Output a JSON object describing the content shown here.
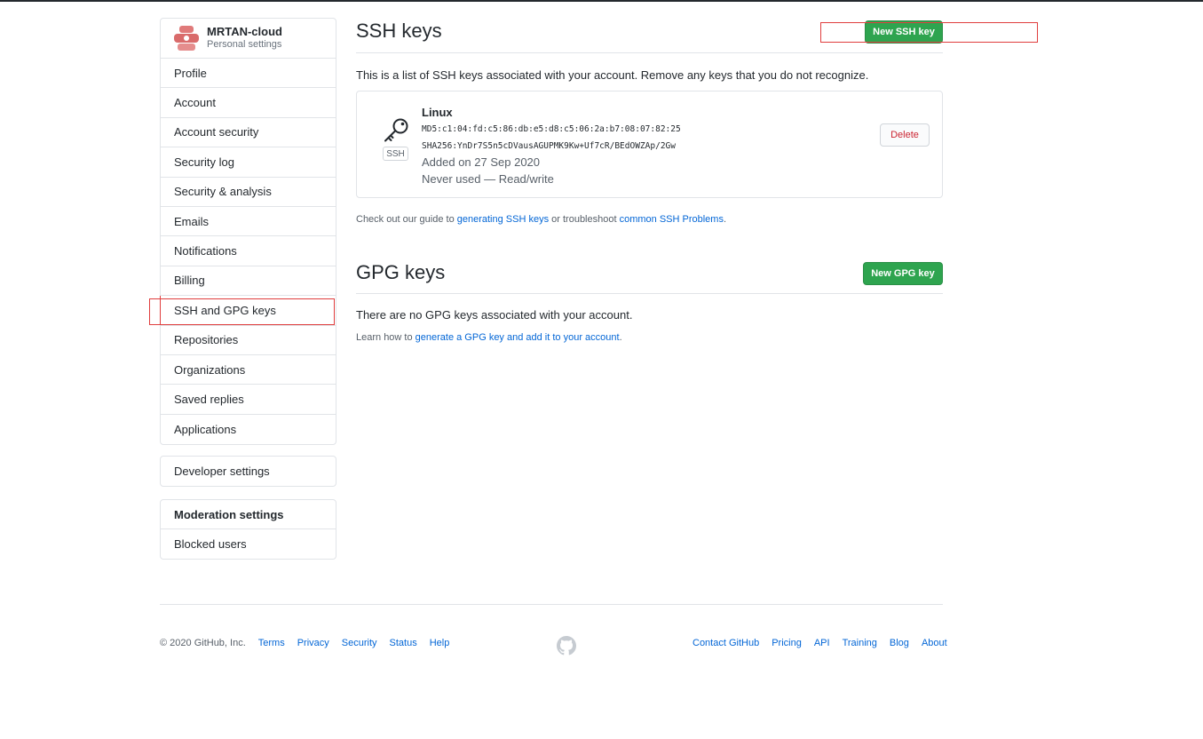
{
  "sidebar": {
    "user": {
      "name": "MRTAN-cloud",
      "subtitle": "Personal settings"
    },
    "items": [
      {
        "label": "Profile"
      },
      {
        "label": "Account"
      },
      {
        "label": "Account security"
      },
      {
        "label": "Security log"
      },
      {
        "label": "Security & analysis"
      },
      {
        "label": "Emails"
      },
      {
        "label": "Notifications"
      },
      {
        "label": "Billing"
      },
      {
        "label": "SSH and GPG keys",
        "selected": true
      },
      {
        "label": "Repositories"
      },
      {
        "label": "Organizations"
      },
      {
        "label": "Saved replies"
      },
      {
        "label": "Applications"
      }
    ],
    "developer": {
      "label": "Developer settings"
    },
    "moderation": {
      "heading": "Moderation settings",
      "items": [
        {
          "label": "Blocked users"
        }
      ]
    }
  },
  "ssh": {
    "title": "SSH keys",
    "new_button": "New SSH key",
    "description": "This is a list of SSH keys associated with your account. Remove any keys that you do not recognize.",
    "keys": [
      {
        "title": "Linux",
        "badge": "SSH",
        "md5": "MD5:c1:04:fd:c5:86:db:e5:d8:c5:06:2a:b7:08:07:82:25",
        "sha256": "SHA256:YnDr7S5n5cDVausAGUPMK9Kw+Uf7cR/BEdOWZAp/2Gw",
        "added": "Added on 27 Sep 2020",
        "usage": "Never used — Read/write",
        "delete_label": "Delete"
      }
    ],
    "guide": {
      "prefix": "Check out our guide to ",
      "link1": "generating SSH keys",
      "middle": " or troubleshoot ",
      "link2": "common SSH Problems",
      "suffix": "."
    }
  },
  "gpg": {
    "title": "GPG keys",
    "new_button": "New GPG key",
    "empty_text": "There are no GPG keys associated with your account.",
    "learn": {
      "prefix": "Learn how to ",
      "link": "generate a GPG key and add it to your account",
      "suffix": "."
    }
  },
  "footer": {
    "copyright": "© 2020 GitHub, Inc.",
    "left_links": [
      "Terms",
      "Privacy",
      "Security",
      "Status",
      "Help"
    ],
    "right_links": [
      "Contact GitHub",
      "Pricing",
      "API",
      "Training",
      "Blog",
      "About"
    ]
  },
  "icons": {
    "key": "key-icon",
    "footer_logo": "github-mark-icon"
  },
  "colors": {
    "primary_button": "#2ea44f",
    "link": "#0366d6",
    "danger": "#cb2431",
    "highlight_box": "#e03e3e"
  }
}
